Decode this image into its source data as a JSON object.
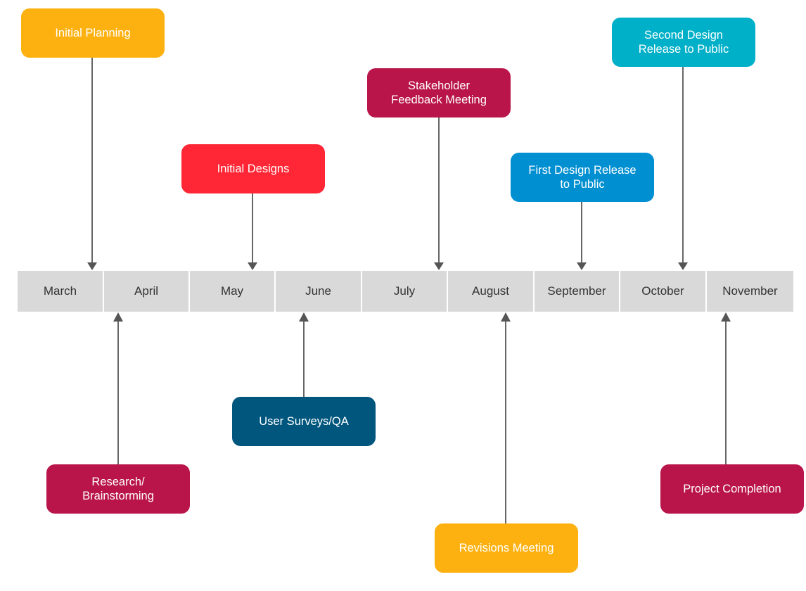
{
  "timeline": {
    "months": [
      "March",
      "April",
      "May",
      "June",
      "July",
      "August",
      "September",
      "October",
      "November"
    ],
    "colors": {
      "month_bg": "#d9d9d9",
      "month_text": "#333333",
      "connector": "#666666"
    },
    "events": [
      {
        "id": "initial-planning",
        "label": "Initial Planning",
        "month": "March",
        "side": "above",
        "color": "#fcb111"
      },
      {
        "id": "research-brainstorming",
        "label": "Research/\nBrainstorming",
        "month": "April",
        "side": "below",
        "color": "#b9154a"
      },
      {
        "id": "initial-designs",
        "label": "Initial Designs",
        "month": "May",
        "side": "above",
        "color": "#ff2735"
      },
      {
        "id": "user-surveys-qa",
        "label": "User Surveys/QA",
        "month": "June",
        "side": "below",
        "color": "#00567d"
      },
      {
        "id": "stakeholder-feedback-meeting",
        "label": "Stakeholder\nFeedback Meeting",
        "month": "July",
        "side": "above",
        "color": "#b9154a"
      },
      {
        "id": "revisions-meeting",
        "label": "Revisions Meeting",
        "month": "August",
        "side": "below",
        "color": "#fcb111"
      },
      {
        "id": "first-design-release",
        "label": "First Design Release\nto Public",
        "month": "September",
        "side": "above",
        "color": "#008fd1"
      },
      {
        "id": "second-design-release",
        "label": "Second Design\nRelease to Public",
        "month": "October",
        "side": "above",
        "color": "#00b0c8"
      },
      {
        "id": "project-completion",
        "label": "Project Completion",
        "month": "November",
        "side": "below",
        "color": "#b9154a"
      }
    ]
  }
}
